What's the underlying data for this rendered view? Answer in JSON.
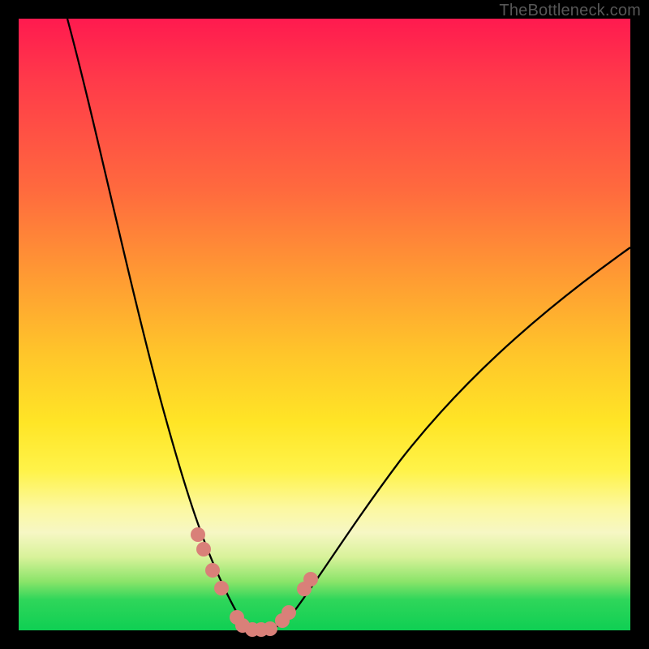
{
  "attribution": "TheBottleneck.com",
  "colors": {
    "gradient_top": "#ff1a4f",
    "gradient_mid": "#ffe526",
    "gradient_bottom": "#0fcf53",
    "curve": "#000000",
    "bead": "#d98079",
    "frame": "#000000"
  },
  "chart_data": {
    "type": "line",
    "title": "",
    "xlabel": "",
    "ylabel": "",
    "xlim": [
      0,
      100
    ],
    "ylim": [
      0,
      100
    ],
    "notes": "V-shaped bottleneck curve on rainbow gradient. y = 0 (green) at trough x≈36–41; curve rises on both sides. Left branch hits top (y=100) near x≈8; right branch exits right edge near y≈63. Coral 'beads' mark data points on both branches near the bottom.",
    "series": [
      {
        "name": "left-branch",
        "x": [
          8,
          12,
          16,
          20,
          24,
          27,
          29,
          31,
          33,
          35,
          36,
          37
        ],
        "y": [
          100,
          79,
          60,
          44,
          31,
          22,
          16,
          11,
          7,
          3,
          1,
          0
        ]
      },
      {
        "name": "trough",
        "x": [
          37,
          38,
          39,
          40,
          41
        ],
        "y": [
          0,
          0,
          0,
          0,
          0
        ]
      },
      {
        "name": "right-branch",
        "x": [
          41,
          43,
          45,
          48,
          52,
          58,
          66,
          76,
          88,
          100
        ],
        "y": [
          0,
          2,
          5,
          9,
          15,
          23,
          33,
          44,
          54,
          63
        ]
      }
    ],
    "beads": [
      {
        "branch": "left",
        "x": 29.0,
        "y": 16.0
      },
      {
        "branch": "left",
        "x": 30.0,
        "y": 13.5
      },
      {
        "branch": "left",
        "x": 31.5,
        "y": 10.0
      },
      {
        "branch": "left",
        "x": 33.0,
        "y": 7.0
      },
      {
        "branch": "left",
        "x": 35.5,
        "y": 2.0
      },
      {
        "branch": "left",
        "x": 36.5,
        "y": 0.5
      },
      {
        "branch": "floor",
        "x": 38.0,
        "y": 0.0
      },
      {
        "branch": "floor",
        "x": 39.5,
        "y": 0.0
      },
      {
        "branch": "floor",
        "x": 41.0,
        "y": 0.0
      },
      {
        "branch": "right",
        "x": 43.0,
        "y": 2.0
      },
      {
        "branch": "right",
        "x": 44.0,
        "y": 4.0
      },
      {
        "branch": "right",
        "x": 46.5,
        "y": 7.5
      },
      {
        "branch": "right",
        "x": 47.5,
        "y": 9.0
      }
    ]
  }
}
